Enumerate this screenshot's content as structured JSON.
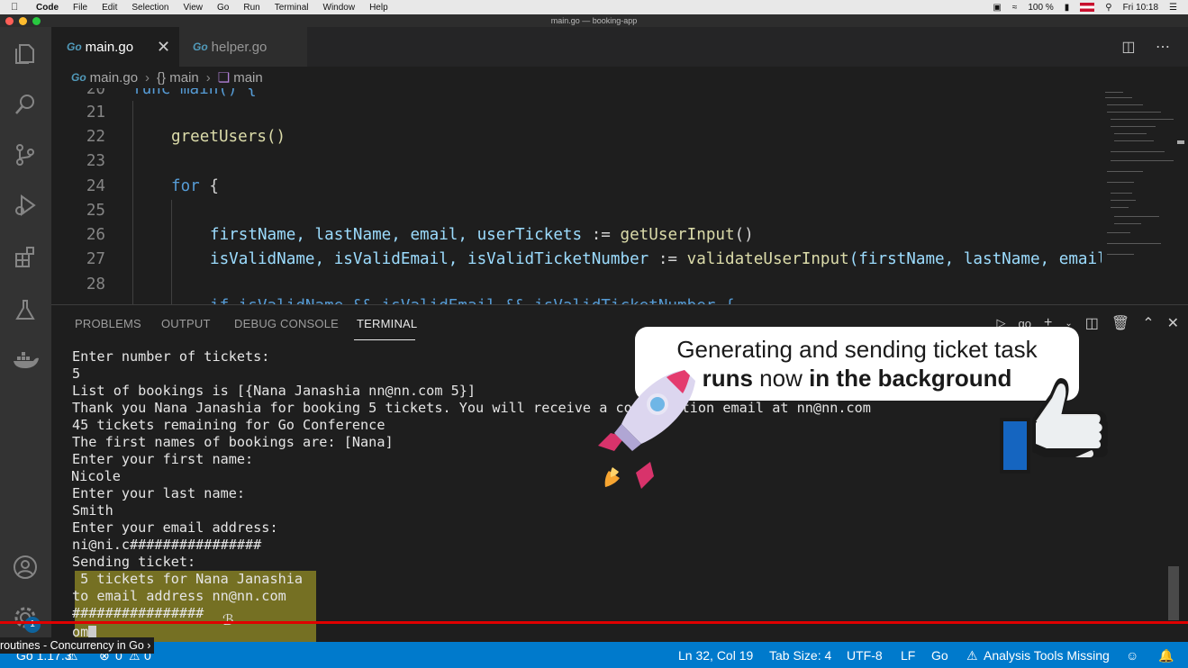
{
  "menubar": {
    "app": "Code",
    "items": [
      "File",
      "Edit",
      "Selection",
      "View",
      "Go",
      "Run",
      "Terminal",
      "Window",
      "Help"
    ],
    "battery": "100 %",
    "clock": "Fri 10:18"
  },
  "window": {
    "title": "main.go — booking-app"
  },
  "tabs": [
    {
      "label": "main.go",
      "go": "Go",
      "active": true
    },
    {
      "label": "helper.go",
      "go": "Go",
      "active": false
    }
  ],
  "breadcrumb": {
    "file": "main.go",
    "func1": "{} main",
    "func2": "main",
    "go": "Go"
  },
  "editor": {
    "lines": [
      {
        "n": "20",
        "text": "func main() {"
      },
      {
        "n": "21",
        "text": ""
      },
      {
        "n": "22",
        "text": "greetUsers()"
      },
      {
        "n": "23",
        "text": ""
      },
      {
        "n": "24",
        "kw": "for",
        "rest": " {"
      },
      {
        "n": "25",
        "text": ""
      },
      {
        "n": "26",
        "vars": "firstName, lastName, email, userTickets",
        "op": " := ",
        "fn": "getUserInput",
        "tail": "()"
      },
      {
        "n": "27",
        "vars": "isValidName, isValidEmail, isValidTicketNumber",
        "op": " := ",
        "fn": "validateUserInput",
        "tail": "(firstName, lastName, email"
      },
      {
        "n": "28",
        "text": ""
      },
      {
        "n": "29",
        "text": "if isValidName && isValidEmail && isValidTicketNumber {"
      }
    ]
  },
  "panel": {
    "tabs": [
      "PROBLEMS",
      "OUTPUT",
      "DEBUG CONSOLE",
      "TERMINAL"
    ],
    "active_tab": "TERMINAL",
    "terminal_name": "go"
  },
  "terminal": {
    "lines": [
      "Enter number of tickets:",
      "5",
      "List of bookings is [{Nana Janashia nn@nn.com 5}]",
      "Thank you Nana Janashia for booking 5 tickets. You will receive a confirmation email at nn@nn.com",
      "45 tickets remaining for Go Conference",
      "The first names of bookings are: [Nana]",
      "Enter your first name:",
      "Nicole",
      "Enter your last name:",
      "Smith",
      "Enter your email address:",
      "ni@ni.c################",
      "Sending ticket:",
      " 5 tickets for Nana Janashia",
      "to email address nn@nn.com",
      "################",
      "om"
    ]
  },
  "callout": {
    "line1": "Generating and sending ticket task",
    "line2_bold1": "runs",
    "line2_mid": " now ",
    "line2_bold2": "in the background"
  },
  "statusbar": {
    "go_version": "Go 1.17.3",
    "errors": "0",
    "warnings": "0",
    "position": "Ln 32, Col 19",
    "tab_size": "Tab Size: 4",
    "encoding": "UTF-8",
    "eol": "LF",
    "language": "Go",
    "analysis": "Analysis Tools Missing"
  },
  "chapter": "routines - Concurrency in Go",
  "settings_badge": "1",
  "colors": {
    "status": "#007acc",
    "progress": "#e00000",
    "highlight": "#beb428"
  }
}
